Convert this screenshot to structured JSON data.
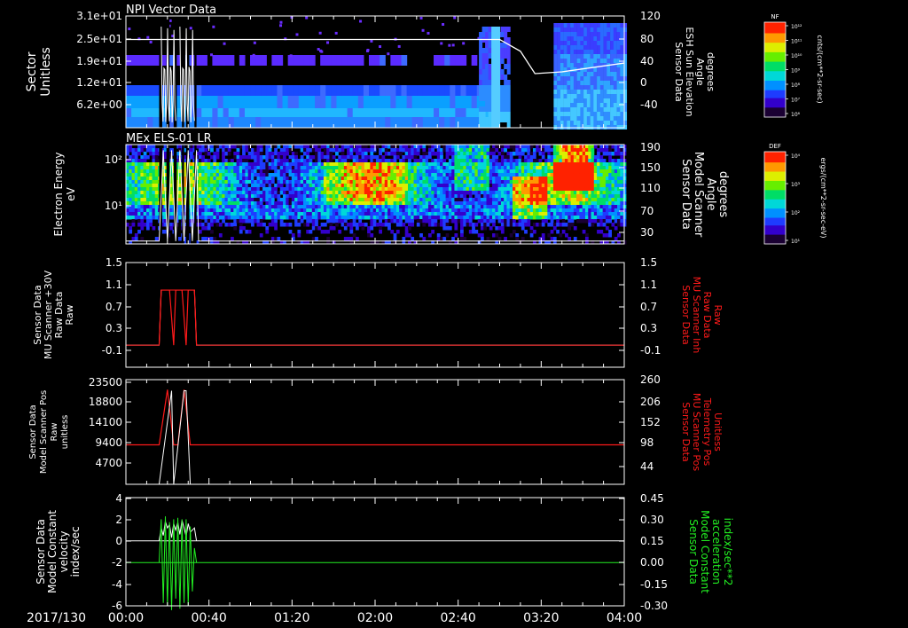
{
  "colors": {
    "background": "#000000",
    "frame": "#ffffff",
    "red": "#ff1a1a",
    "green": "#22ee22",
    "white": "#ffffff"
  },
  "colormap": [
    "#1a0033",
    "#3300cc",
    "#1e3cff",
    "#0090ff",
    "#00d8d8",
    "#00dd66",
    "#66ee00",
    "#ddee00",
    "#ff9900",
    "#ff2200"
  ],
  "panels": [
    {
      "title": "NPI Vector Data",
      "type": "spectrogram",
      "left_label": [
        "Sector",
        "Unitless"
      ],
      "left_ticks": [
        "3.1e+01",
        "2.5e+01",
        "1.9e+01",
        "1.2e+01",
        "6.2e+00"
      ],
      "right_ticks": [
        "120",
        "80",
        "40",
        "0",
        "-40"
      ],
      "right_label": [
        "Sensor Data",
        "ESH Sun Elevation",
        "Angle",
        "degrees"
      ],
      "colorbar": {
        "label": "NF",
        "units": "cnts/(cm**2-sr-sec)",
        "ticks": [
          "10¹²",
          "10¹¹",
          "10¹⁰",
          "10⁹",
          "10⁸",
          "10⁷",
          "10⁶"
        ]
      }
    },
    {
      "title": "MEx ELS-01 LR",
      "type": "spectrogram",
      "left_label": [
        "Electron Energy",
        "eV"
      ],
      "left_ticks": [
        "10²",
        "10¹"
      ],
      "right_ticks": [
        "190",
        "150",
        "110",
        "70",
        "30"
      ],
      "right_label": [
        "Sensor Data",
        "Model Scanner",
        "Angle",
        "degrees"
      ],
      "colorbar": {
        "label": "DEF",
        "units": "ergs/(cm**2-sr-sec-eV)",
        "ticks": [
          "10⁴",
          "10³",
          "10²",
          "10¹"
        ]
      }
    },
    {
      "type": "line",
      "left_label": [
        "Sensor Data",
        "MU Scanner +30V",
        "Raw Data",
        "Raw"
      ],
      "left_ticks": [
        "1.5",
        "1.1",
        "0.7",
        "0.3",
        "-0.1"
      ],
      "right_ticks": [
        "1.5",
        "1.1",
        "0.7",
        "0.3",
        "-0.1"
      ],
      "right_label": [
        "Sensor Data",
        "MU Scanner Inh",
        "Raw Data",
        "Raw"
      ]
    },
    {
      "type": "line",
      "left_label": [
        "Sensor Data",
        "Model Scanner Pos",
        "Raw",
        "unitless"
      ],
      "left_ticks": [
        "23500",
        "18800",
        "14100",
        "9400",
        "4700"
      ],
      "right_ticks": [
        "260",
        "206",
        "152",
        "98",
        "44"
      ],
      "right_label": [
        "Sensor Data",
        "MU Scanner Pos",
        "Telemetry Pos",
        "Unitless"
      ]
    },
    {
      "type": "line",
      "left_label": [
        "Sensor Data",
        "Model Constant",
        "velocity",
        "index/sec"
      ],
      "left_ticks": [
        "4",
        "2",
        "0",
        "-2",
        "-4",
        "-6"
      ],
      "right_ticks": [
        "0.45",
        "0.30",
        "0.15",
        "0.00",
        "-0.15",
        "-0.30"
      ],
      "right_label": [
        "Sensor Data",
        "Model Constant",
        "acceleration",
        "index/sec**2"
      ]
    }
  ],
  "x_axis": {
    "date": "2017/130",
    "ticks": [
      "00:00",
      "00:40",
      "01:20",
      "02:00",
      "02:40",
      "03:20",
      "04:00"
    ]
  },
  "chart_data": [
    {
      "type": "line",
      "title": "NPI Vector Data",
      "series": [
        {
          "name": "Sensor Data ESH Sun Elevation Angle",
          "x": [
            "00:00",
            "00:05",
            "00:15",
            "03:00",
            "03:10",
            "03:17",
            "03:30",
            "04:00"
          ],
          "values": [
            80,
            80,
            80,
            80,
            60,
            22,
            25,
            40
          ]
        }
      ],
      "ylim": [
        -70,
        120
      ]
    },
    {
      "type": "line",
      "series": [
        {
          "name": "Sensor Data MU Scanner +30V Raw Data",
          "x": [
            "00:00",
            "00:16",
            "00:17",
            "00:25",
            "00:33",
            "00:34",
            "04:00"
          ],
          "values": [
            0,
            0,
            1,
            1,
            1,
            0,
            0
          ]
        },
        {
          "name": "Sensor Data MU Scanner Inh Raw Data",
          "x": [
            "00:00",
            "00:16",
            "00:17",
            "00:25",
            "00:33",
            "00:34",
            "04:00"
          ],
          "values": [
            0,
            0,
            1,
            1,
            1,
            0,
            0
          ]
        }
      ],
      "ylim": [
        -0.4,
        1.5
      ]
    },
    {
      "type": "line",
      "series": [
        {
          "name": "Sensor Data Model Scanner Pos Raw",
          "x": [
            "00:16",
            "00:25",
            "00:26",
            "00:33",
            "00:34"
          ],
          "values": [
            0,
            21000,
            0,
            21000,
            0
          ]
        },
        {
          "name": "Sensor Data MU Scanner Pos Telemetry Pos",
          "x": [
            "00:00",
            "00:16",
            "00:25",
            "00:26",
            "00:33",
            "00:34",
            "04:00"
          ],
          "values": [
            98,
            98,
            235,
            98,
            235,
            98,
            98
          ]
        }
      ],
      "ylim": [
        0,
        23500
      ]
    },
    {
      "type": "line",
      "series": [
        {
          "name": "Sensor Data Model Constant velocity",
          "x": [
            "00:00",
            "00:16",
            "00:25",
            "00:34",
            "04:00"
          ],
          "values": [
            0,
            0,
            1.5,
            1.5,
            0
          ]
        },
        {
          "name": "Sensor Data Model Constant acceleration",
          "x": [
            "00:00",
            "00:16",
            "00:34",
            "04:00"
          ],
          "values": [
            0,
            0,
            0,
            0
          ]
        }
      ],
      "ylim": [
        -6,
        4
      ]
    }
  ]
}
